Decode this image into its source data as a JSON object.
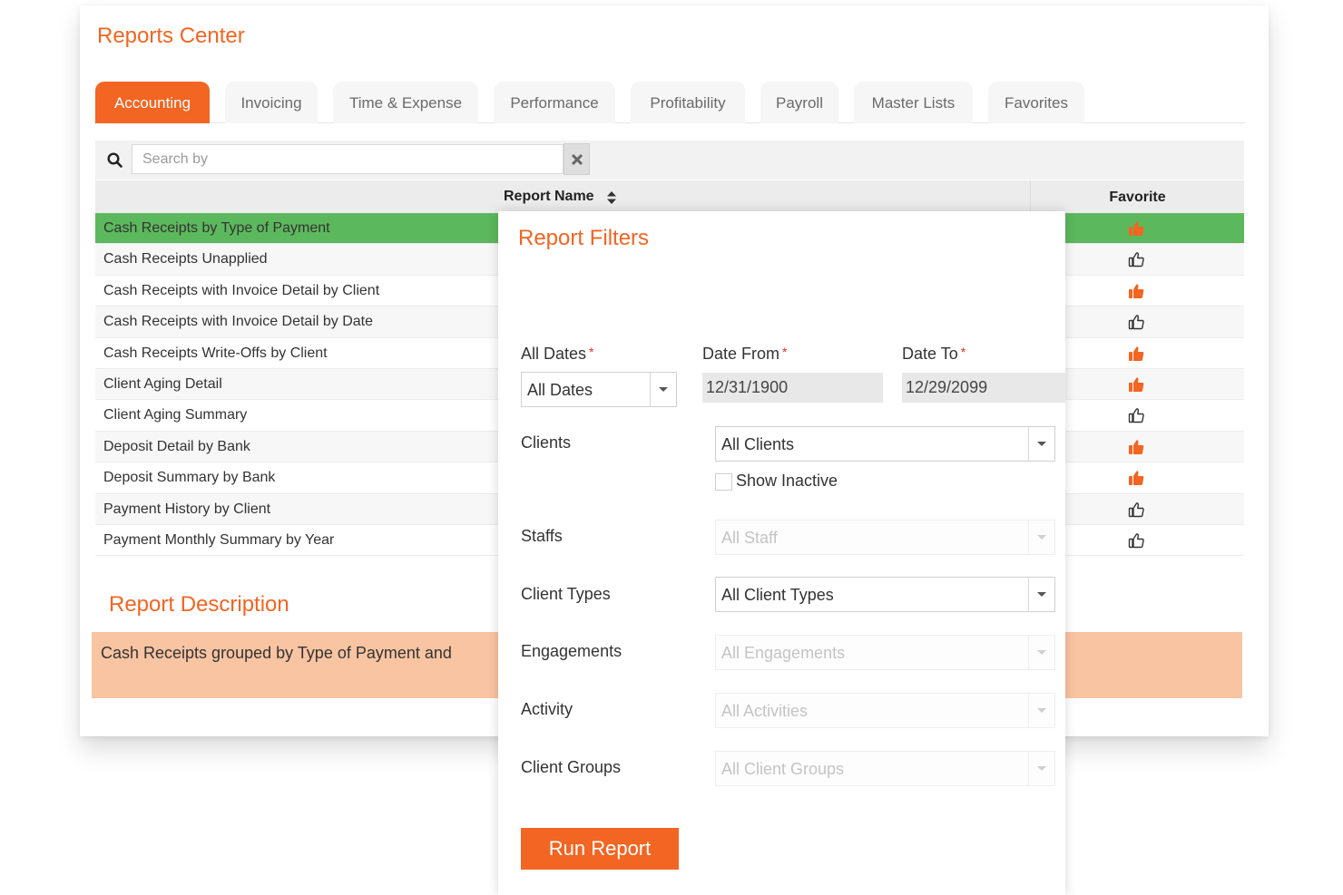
{
  "app": {
    "title": "Reports Center"
  },
  "tabs": [
    {
      "label": "Accounting",
      "active": true
    },
    {
      "label": "Invoicing"
    },
    {
      "label": "Time & Expense"
    },
    {
      "label": "Performance"
    },
    {
      "label": "Profitability"
    },
    {
      "label": "Payroll"
    },
    {
      "label": "Master Lists"
    },
    {
      "label": "Favorites"
    }
  ],
  "search": {
    "placeholder": "Search by",
    "value": "",
    "icon": "search-icon",
    "clear_icon": "close-icon"
  },
  "table": {
    "columns": {
      "name": "Report Name",
      "favorite": "Favorite"
    },
    "rows": [
      {
        "name": "Cash Receipts by Type of Payment",
        "favorite": true,
        "selected": true
      },
      {
        "name": "Cash Receipts Unapplied",
        "favorite": false
      },
      {
        "name": "Cash Receipts with Invoice Detail by Client",
        "favorite": true
      },
      {
        "name": "Cash Receipts with Invoice Detail by Date",
        "favorite": false
      },
      {
        "name": "Cash Receipts Write-Offs by Client",
        "favorite": true
      },
      {
        "name": "Client Aging Detail",
        "favorite": true
      },
      {
        "name": "Client Aging Summary",
        "favorite": false
      },
      {
        "name": "Deposit Detail by Bank",
        "favorite": true
      },
      {
        "name": "Deposit Summary by Bank",
        "favorite": true
      },
      {
        "name": "Payment History by Client",
        "favorite": false
      },
      {
        "name": "Payment Monthly Summary by Year",
        "favorite": false
      }
    ]
  },
  "description": {
    "title": "Report Description",
    "text": "Cash Receipts grouped by Type of Payment and "
  },
  "filters": {
    "title": "Report Filters",
    "all_dates": {
      "label": "All Dates",
      "required": "*",
      "value": "All Dates"
    },
    "date_from": {
      "label": "Date From",
      "required": "*",
      "value": "12/31/1900"
    },
    "date_to": {
      "label": "Date To",
      "required": "*",
      "value": "12/29/2099"
    },
    "clients": {
      "label": "Clients",
      "value": "All Clients"
    },
    "show_inactive": {
      "label": "Show Inactive",
      "checked": false
    },
    "staffs": {
      "label": "Staffs",
      "value": "All Staff",
      "disabled": true
    },
    "client_types": {
      "label": "Client Types",
      "value": "All Client Types"
    },
    "engagements": {
      "label": "Engagements",
      "value": "All Engagements",
      "disabled": true
    },
    "activity": {
      "label": "Activity",
      "value": "All Activities",
      "disabled": true
    },
    "client_groups": {
      "label": "Client Groups",
      "value": "All Client Groups",
      "disabled": true
    },
    "run_label": "Run Report"
  },
  "colors": {
    "accent": "#f26522",
    "selected_row": "#5cb85c",
    "description_bg": "#f9c4a2",
    "required": "#e0301e"
  }
}
